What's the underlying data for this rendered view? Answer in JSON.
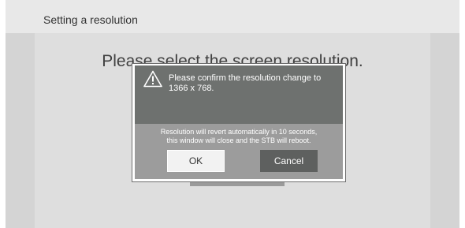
{
  "header": {
    "title": "Setting a resolution"
  },
  "background": {
    "prompt": "Please select the screen resolution."
  },
  "dialog": {
    "icon": "warning-icon",
    "message_line1": "Please confirm the resolution change to",
    "message_line2": "1366 x 768.",
    "note_line1": "Resolution will revert automatically in 10 seconds,",
    "note_line2": "this window will close and the STB will reboot.",
    "ok_label": "OK",
    "cancel_label": "Cancel"
  },
  "colors": {
    "dialog_header": "#6e716f",
    "dialog_body": "#9c9c9c",
    "cancel_button": "#5e605f",
    "ok_button": "#f2f2f2"
  }
}
